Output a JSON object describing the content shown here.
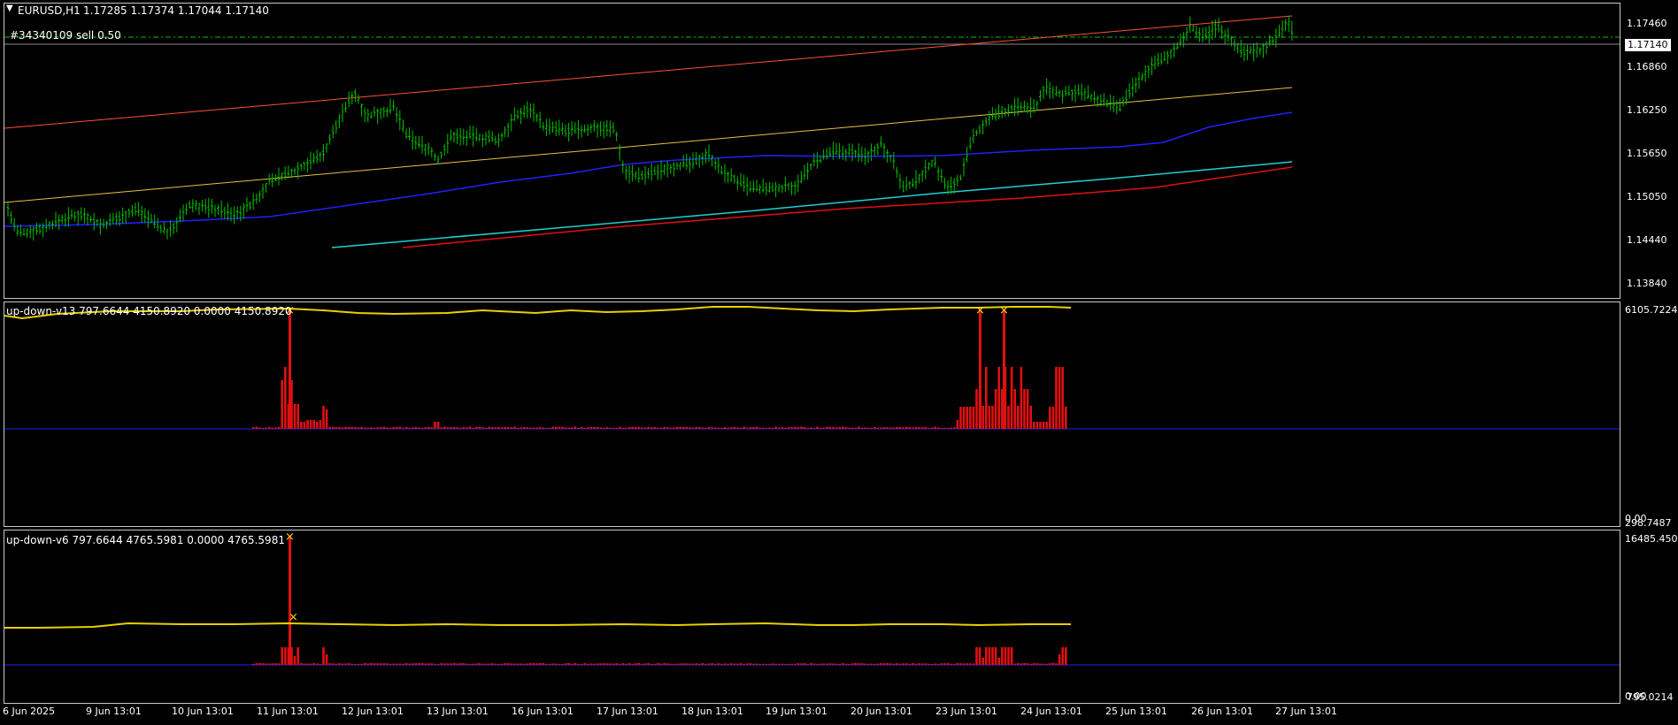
{
  "main": {
    "symbol": "EURUSD,H1",
    "ohlc": "1.17285 1.17374 1.17044 1.17140",
    "order": "#34340109 sell 0.50",
    "current_price": "1.17140",
    "price_ticks": [
      "1.17460",
      "1.16860",
      "1.16250",
      "1.15650",
      "1.15050",
      "1.14440",
      "1.13840"
    ],
    "colors": {
      "candle": "#00c000",
      "upper_band": "#ff5030",
      "mid_band": "#e8c040",
      "ma_blue": "#2020ff",
      "ma_cyan": "#20d0d0",
      "ma_red": "#e01010"
    }
  },
  "ind1": {
    "title": "up-down-v13 797.6644 4150.8920 0.0000 4150.8920",
    "axis_top": "6105.7224",
    "axis_bottom_a": "0.00",
    "axis_bottom_b": "298.7487"
  },
  "ind2": {
    "title": "up-down-v6 797.6644 4765.5981 0.0000 4765.5981",
    "axis_top": "16485.450",
    "axis_bottom_a": "0.00",
    "axis_bottom_b": "795.0214"
  },
  "time_axis": [
    "6 Jun 2025",
    "9 Jun 13:01",
    "10 Jun 13:01",
    "11 Jun 13:01",
    "12 Jun 13:01",
    "13 Jun 13:01",
    "16 Jun 13:01",
    "17 Jun 13:01",
    "18 Jun 13:01",
    "19 Jun 13:01",
    "20 Jun 13:01",
    "23 Jun 13:01",
    "24 Jun 13:01",
    "25 Jun 13:01",
    "26 Jun 13:01",
    "27 Jun 13:01"
  ]
}
